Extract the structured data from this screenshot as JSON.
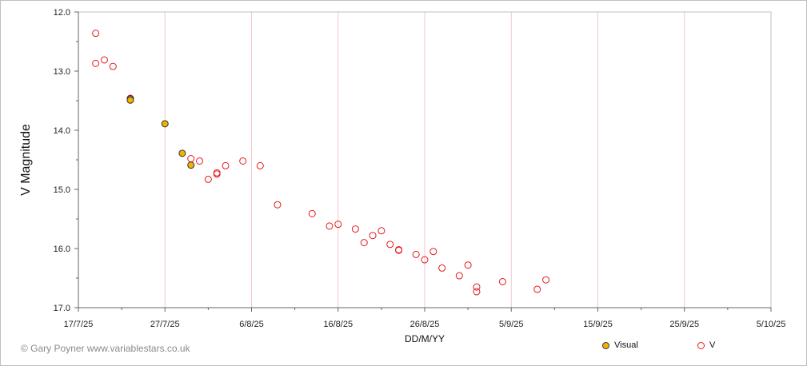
{
  "chart_data": {
    "type": "scatter",
    "title": "",
    "xlabel": "DD/M/YY",
    "ylabel": "V Magnitude",
    "x_ticks": [
      "17/7/25",
      "27/7/25",
      "6/8/25",
      "16/8/25",
      "26/8/25",
      "5/9/25",
      "15/9/25",
      "25/9/25",
      "5/10/25"
    ],
    "y_ticks": [
      "12.0",
      "13.0",
      "14.0",
      "15.0",
      "16.0",
      "17.0"
    ],
    "xlim": [
      "2025-07-17",
      "2025-10-05"
    ],
    "ylim": [
      12.0,
      17.0
    ],
    "y_inverted": true,
    "grid": "vertical only",
    "legend_position": "bottom-right",
    "series": [
      {
        "name": "Visual",
        "marker": "filled circle",
        "color": "#f2b200",
        "edge_color": "#333333",
        "points": [
          {
            "x": "2025-07-23",
            "y": 13.47
          },
          {
            "x": "2025-07-23",
            "y": 13.49
          },
          {
            "x": "2025-07-27",
            "y": 13.89
          },
          {
            "x": "2025-07-29",
            "y": 14.39
          },
          {
            "x": "2025-07-30",
            "y": 14.59
          }
        ]
      },
      {
        "name": "V",
        "marker": "open circle",
        "color": "#e8171c",
        "points": [
          {
            "x": "2025-07-19",
            "y": 12.36
          },
          {
            "x": "2025-07-19",
            "y": 12.87
          },
          {
            "x": "2025-07-20",
            "y": 12.81
          },
          {
            "x": "2025-07-21",
            "y": 12.92
          },
          {
            "x": "2025-07-23",
            "y": 13.46
          },
          {
            "x": "2025-07-30",
            "y": 14.48
          },
          {
            "x": "2025-07-31",
            "y": 14.52
          },
          {
            "x": "2025-08-01",
            "y": 14.83
          },
          {
            "x": "2025-08-02",
            "y": 14.72
          },
          {
            "x": "2025-08-02",
            "y": 14.74
          },
          {
            "x": "2025-08-03",
            "y": 14.6
          },
          {
            "x": "2025-08-05",
            "y": 14.52
          },
          {
            "x": "2025-08-07",
            "y": 14.6
          },
          {
            "x": "2025-08-09",
            "y": 15.26
          },
          {
            "x": "2025-08-13",
            "y": 15.41
          },
          {
            "x": "2025-08-15",
            "y": 15.62
          },
          {
            "x": "2025-08-16",
            "y": 15.59
          },
          {
            "x": "2025-08-18",
            "y": 15.67
          },
          {
            "x": "2025-08-19",
            "y": 15.9
          },
          {
            "x": "2025-08-20",
            "y": 15.78
          },
          {
            "x": "2025-08-21",
            "y": 15.7
          },
          {
            "x": "2025-08-22",
            "y": 15.93
          },
          {
            "x": "2025-08-23",
            "y": 16.02
          },
          {
            "x": "2025-08-23",
            "y": 16.03
          },
          {
            "x": "2025-08-25",
            "y": 16.1
          },
          {
            "x": "2025-08-26",
            "y": 16.19
          },
          {
            "x": "2025-08-27",
            "y": 16.05
          },
          {
            "x": "2025-08-28",
            "y": 16.33
          },
          {
            "x": "2025-08-30",
            "y": 16.46
          },
          {
            "x": "2025-08-31",
            "y": 16.28
          },
          {
            "x": "2025-09-01",
            "y": 16.65
          },
          {
            "x": "2025-09-01",
            "y": 16.73
          },
          {
            "x": "2025-09-04",
            "y": 16.56
          },
          {
            "x": "2025-09-08",
            "y": 16.69
          },
          {
            "x": "2025-09-09",
            "y": 16.53
          }
        ]
      }
    ]
  },
  "credit": "© Gary Poyner www.variablestars.co.uk",
  "legend": [
    {
      "label": "Visual",
      "fill": "#f2b200",
      "stroke": "#333333"
    },
    {
      "label": "V",
      "fill": "#ffffff",
      "stroke": "#e8171c"
    }
  ]
}
